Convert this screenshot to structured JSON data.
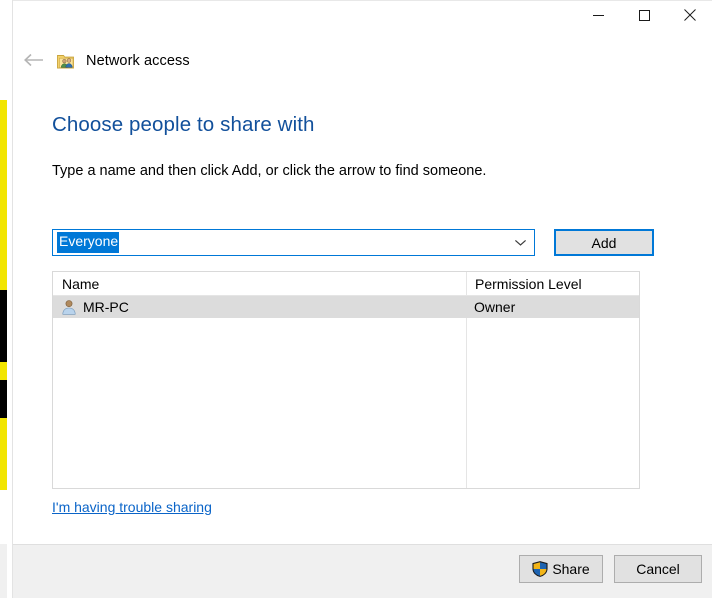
{
  "window": {
    "title": "Network access",
    "title_icon": "share-folder-people-icon",
    "back_arrow_icon": "back-arrow-icon",
    "controls": [
      {
        "name": "minimize",
        "icon": "minimize-icon",
        "label": "─"
      },
      {
        "name": "maximize",
        "icon": "maximize-icon",
        "label": "□"
      },
      {
        "name": "close",
        "icon": "close-icon",
        "label": "✕"
      }
    ]
  },
  "content": {
    "heading": "Choose people to share with",
    "instruction": "Type a name and then click Add, or click the arrow to find someone.",
    "combo": {
      "value": "Everyone",
      "placeholder": "",
      "arrow_icon": "chevron-down-icon",
      "selected": true
    },
    "add_button": "Add",
    "list": {
      "columns": [
        "Name",
        "Permission Level"
      ],
      "rows": [
        {
          "name": "MR-PC",
          "permission": "Owner",
          "icon": "user-icon",
          "selected": true
        }
      ]
    },
    "trouble_link": "I'm having trouble sharing"
  },
  "footer": {
    "share_button": "Share",
    "share_icon": "uac-shield-icon",
    "cancel_button": "Cancel"
  },
  "colors": {
    "heading_blue": "#12509b",
    "link_blue": "#0a64c8",
    "accent_blue": "#0078d7",
    "selection_blue": "#0078d7",
    "row_selected_gray": "#dcdcdc",
    "footer_gray": "#f0f0f0",
    "button_face": "#e1e1e1"
  }
}
